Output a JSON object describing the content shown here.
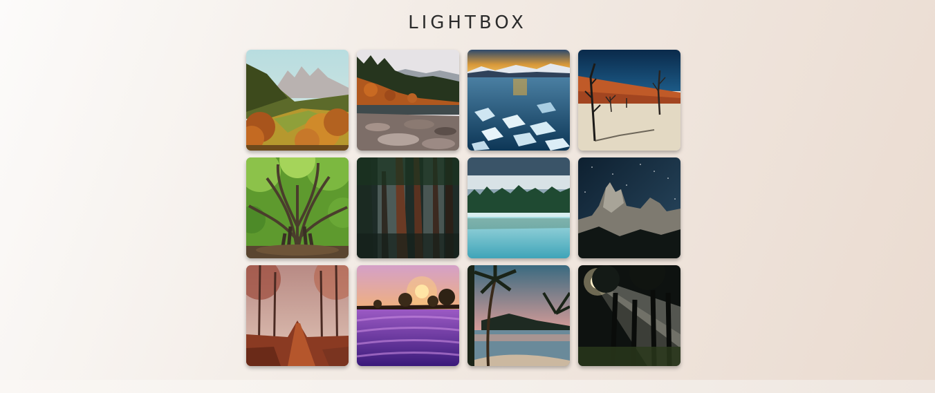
{
  "title": "LIGHTBOX",
  "gallery": [
    {
      "id": "photo-autumn-mountain-valley"
    },
    {
      "id": "photo-rocky-lakeshore-forest"
    },
    {
      "id": "photo-frozen-lake-sunset"
    },
    {
      "id": "photo-dead-trees-red-dunes"
    },
    {
      "id": "photo-banyan-tree"
    },
    {
      "id": "photo-redwood-forest"
    },
    {
      "id": "photo-misty-lake-forest"
    },
    {
      "id": "photo-rock-formation-night-sky"
    },
    {
      "id": "photo-autumn-forest-path"
    },
    {
      "id": "photo-lavender-field-sunset"
    },
    {
      "id": "photo-palm-beach-sunset"
    },
    {
      "id": "photo-forest-sun-rays"
    }
  ]
}
